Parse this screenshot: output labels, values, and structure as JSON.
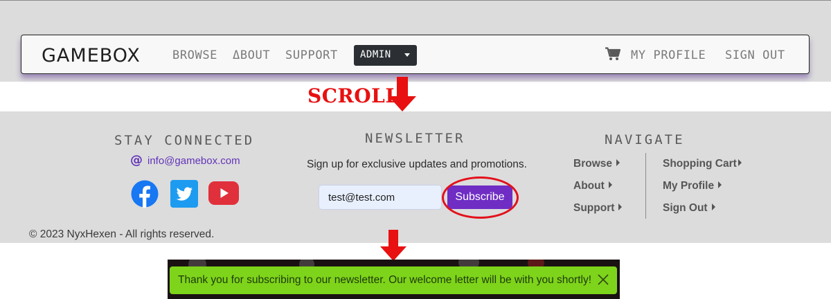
{
  "navbar": {
    "brand": "GAMEBOX",
    "links": {
      "browse": "BROWSE",
      "about": "ΔBOUT",
      "support": "SUPPORT"
    },
    "admin_label": "ADMIN",
    "profile": "MY PROFILE",
    "sign_out": "SIGN OUT"
  },
  "annotation": {
    "scroll_label": "SCROLL"
  },
  "footer": {
    "stay_connected": {
      "heading": "STAY CONNECTED",
      "email": "info@gamebox.com"
    },
    "newsletter": {
      "heading": "NEWSLETTER",
      "subtitle": "Sign up for exclusive updates and promotions.",
      "email_value": "test@test.com",
      "subscribe_label": "Subscribe"
    },
    "navigate": {
      "heading": "NAVIGATE",
      "browse": "Browse",
      "about": "About",
      "support": "Support",
      "cart": "Shopping Cart",
      "profile": "My Profile",
      "sign_out": "Sign Out"
    },
    "copyright": "© 2023 NyxHexen - All rights reserved."
  },
  "toast": {
    "message": "Thank you for subscribing to our newsletter. Our welcome letter will be with you shortly!"
  },
  "colors": {
    "accent_purple": "#6f2dc4",
    "facebook": "#1877f2",
    "twitter": "#1d9bf0",
    "youtube": "#e0303b",
    "annotation_red": "#e81010",
    "toast_green": "#7ed41a"
  },
  "icons": [
    "cart-icon",
    "at-icon",
    "facebook-icon",
    "twitter-icon",
    "youtube-icon",
    "caret-down-icon",
    "caret-right-icon",
    "close-icon",
    "down-arrow-icon"
  ]
}
